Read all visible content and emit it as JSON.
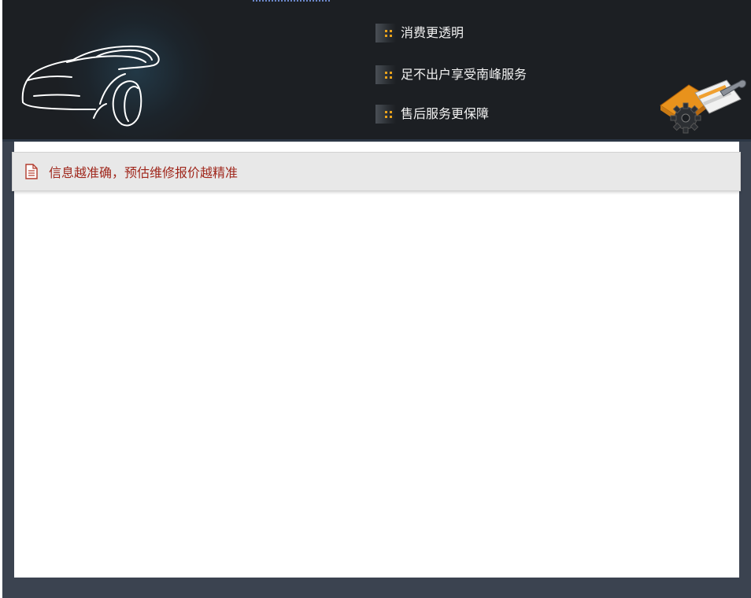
{
  "banner": {
    "features": [
      {
        "label": "消费更透明"
      },
      {
        "label": "足不出户享受南峰服务"
      },
      {
        "label": "售后服务更保障"
      }
    ],
    "icons": {
      "car": "car-outline-icon",
      "tools": "tools-gear-icon",
      "bullet": "dots-bullet-icon"
    }
  },
  "notice": {
    "icon": "document-icon",
    "text": "信息越准确，预估维修报价越精准"
  },
  "colors": {
    "banner_bg": "#1c1f23",
    "frame_bg": "#3b4350",
    "bullet_accent": "#e9a21c",
    "notice_text": "#a0271c",
    "notice_bg": "#e8e8e8"
  }
}
